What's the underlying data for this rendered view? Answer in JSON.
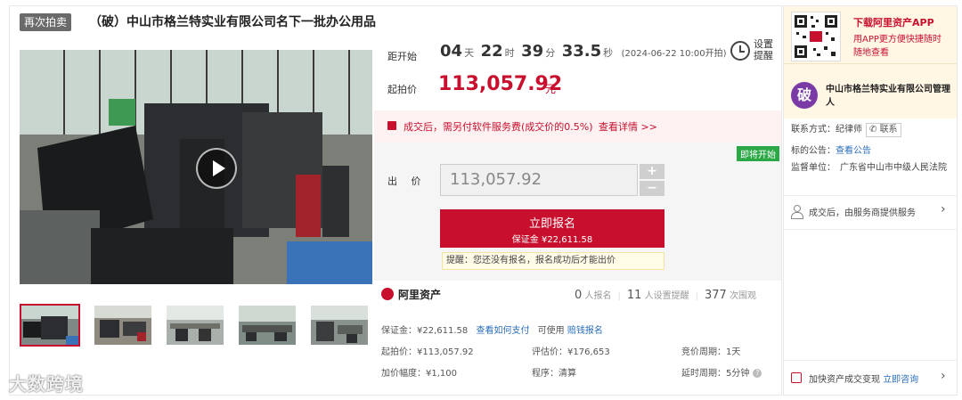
{
  "header": {
    "badge": "再次拍卖",
    "title": "（破）中山市格兰特实业有限公司名下一批办公用品"
  },
  "countdown": {
    "label": "距开始",
    "days": "04",
    "days_unit": "天",
    "hours": "22",
    "hours_unit": "时",
    "minutes": "39",
    "minutes_unit": "分",
    "seconds": "33.5",
    "seconds_unit": "秒",
    "start_time": "(2024-06-22 10:00开拍)",
    "remind_label": "设置提醒"
  },
  "price": {
    "label": "起拍价",
    "value": "113,057.92",
    "unit": "元"
  },
  "fee": {
    "text": "成交后，需另付软件服务费(成交价的0.5%)",
    "link": "查看详情 >>"
  },
  "bid": {
    "tag": "即将开始",
    "label": "出 价",
    "input_value": "113,057.92",
    "plus": "+",
    "minus": "−",
    "signup_label": "立即报名",
    "deposit_label": "保证金 ¥22,611.58",
    "tip": "提醒：您还没有报名，报名成功后才能出价"
  },
  "platform": {
    "name": "阿里资产",
    "signups": "0",
    "signups_unit": "人报名",
    "reminders": "11",
    "reminders_unit": "人设置提醒",
    "views": "377",
    "views_unit": "次围观"
  },
  "details": {
    "deposit": "保证金：¥22,611.58",
    "pay_link": "查看如何支付",
    "insurance_prefix": "可使用",
    "insurance_link": "赔钱报名",
    "start_price": "起拍价：¥113,057.92",
    "appraisal": "评估价：¥176,653",
    "cycle": "竞价周期：1天",
    "increment": "加价幅度：¥1,100",
    "procedure": "程序：清算",
    "delay": "延时周期：5分钟"
  },
  "sidebar": {
    "app_title": "下载阿里资产APP",
    "app_desc": "用APP更方便快捷随时随地查看",
    "avatar_char": "破",
    "owner": "中山市格兰特实业有限公司管理人",
    "contact_label": "联系方式：纪律师",
    "contact_btn": "联系",
    "notice_label": "标的公告：",
    "notice_link": "查看公告",
    "court_label": "监督单位：",
    "court_value": "广东省中山市中级人民法院",
    "service_text": "成交后，由服务商提供服务",
    "speed_text": "加快资产成交变现",
    "speed_link": "立即咨询"
  },
  "watermark": "大数跨境",
  "colors": {
    "accent": "#c8102e",
    "link": "#2a6ebb",
    "green": "#2aa845"
  }
}
